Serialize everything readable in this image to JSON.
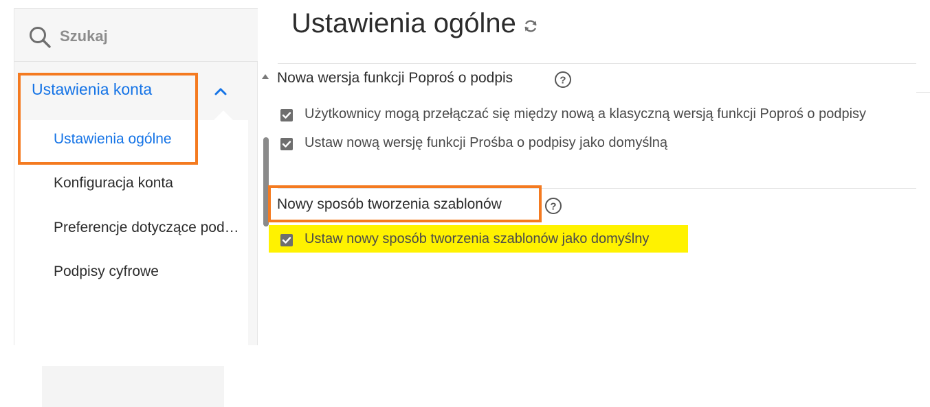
{
  "search": {
    "placeholder": "Szukaj"
  },
  "sidebar": {
    "group_label": "Ustawienia konta",
    "items": [
      {
        "label": "Ustawienia ogólne",
        "active": true
      },
      {
        "label": "Konfiguracja konta",
        "active": false
      },
      {
        "label": "Preferencje dotyczące podpisu",
        "active": false
      },
      {
        "label": "Podpisy cyfrowe",
        "active": false
      }
    ]
  },
  "main": {
    "title": "Ustawienia ogólne",
    "sections": [
      {
        "title": "Nowa wersja funkcji Poproś o podpis",
        "options": [
          {
            "label": "Użytkownicy mogą przełączać się między nową a klasyczną wersją funkcji Poproś o podpisy",
            "checked": true
          },
          {
            "label": "Ustaw nową wersję funkcji Prośba o podpisy jako domyślną",
            "checked": true
          }
        ]
      },
      {
        "title": "Nowy sposób tworzenia szablonów",
        "options": [
          {
            "label": "Ustaw nowy sposób tworzenia szablonów jako domyślny",
            "checked": true
          }
        ]
      }
    ]
  },
  "colors": {
    "accent": "#1473e6",
    "annotation_orange": "#f47a20",
    "highlight_yellow": "#fff200",
    "checkbox": "#6e6e6e"
  },
  "icons": [
    "search-icon",
    "chevron-up-icon",
    "refresh-icon",
    "help-icon",
    "checkmark-icon"
  ]
}
